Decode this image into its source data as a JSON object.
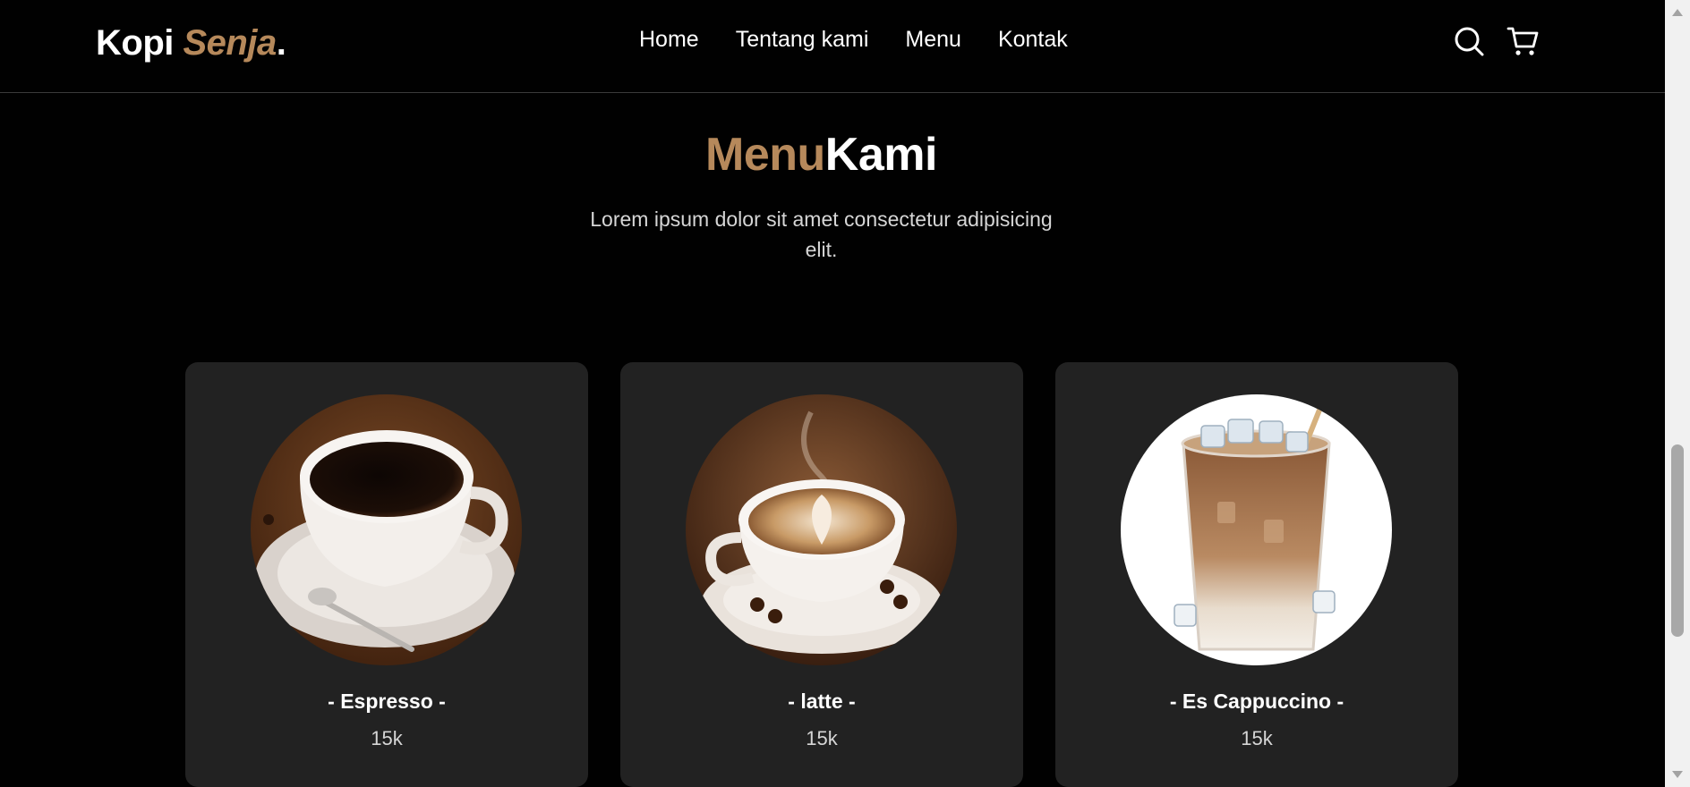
{
  "navbar": {
    "logo_main": "Kopi ",
    "logo_accent": "Senja",
    "logo_dot": ".",
    "links": [
      "Home",
      "Tentang kami",
      "Menu",
      "Kontak"
    ],
    "icons": [
      "search-icon",
      "shopping-cart-icon"
    ]
  },
  "menu_section": {
    "title_accent": "Menu",
    "title_main": "Kami",
    "description": "Lorem ipsum dolor sit amet consectetur adipisicing elit.",
    "cards": [
      {
        "title": "- Espresso -",
        "price": "15k",
        "image": "espresso-cup-image"
      },
      {
        "title": "- latte -",
        "price": "15k",
        "image": "latte-art-cup-image"
      },
      {
        "title": "- Es Cappuccino -",
        "price": "15k",
        "image": "iced-cappuccino-image"
      }
    ]
  },
  "colors": {
    "background": "#010101",
    "accent": "#b6895b",
    "card_background": "#222222"
  }
}
